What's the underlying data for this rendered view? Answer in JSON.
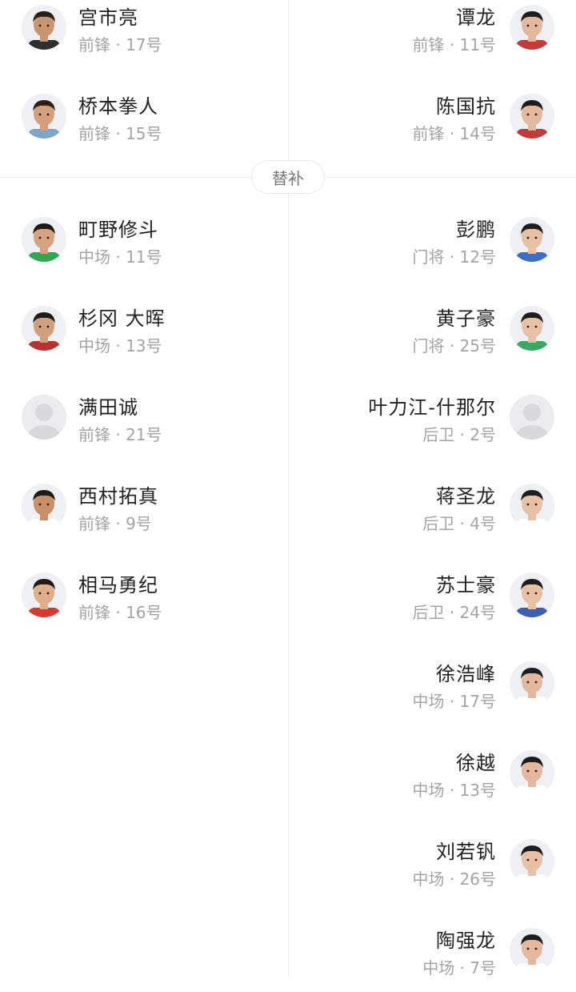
{
  "section": {
    "substitutes_label": "替补"
  },
  "starters": {
    "left": [
      {
        "name": "宫市亮",
        "position": "前锋",
        "number": "17号",
        "photo": "player-photo",
        "skin": "#c99672",
        "hair": "#2a1e17",
        "shirt": "#2f2f2f"
      },
      {
        "name": "桥本拳人",
        "position": "前锋",
        "number": "15号",
        "photo": "player-photo",
        "skin": "#d4a07c",
        "hair": "#2a1e17",
        "shirt": "#7fa6c9"
      }
    ],
    "right": [
      {
        "name": "谭龙",
        "position": "前锋",
        "number": "11号",
        "photo": "player-photo",
        "skin": "#e3b89c",
        "hair": "#1d1d1d",
        "shirt": "#c23a3a"
      },
      {
        "name": "陈国抗",
        "position": "前锋",
        "number": "14号",
        "photo": "player-photo",
        "skin": "#e3b89c",
        "hair": "#1d1d1d",
        "shirt": "#c23a3a"
      }
    ]
  },
  "substitutes": {
    "left": [
      {
        "name": "町野修斗",
        "position": "中场",
        "number": "11号",
        "photo": "player-photo",
        "skin": "#d6a27f",
        "hair": "#1f1a17",
        "shirt": "#2fa84f"
      },
      {
        "name": "杉冈 大晖",
        "position": "中场",
        "number": "13号",
        "photo": "player-photo",
        "skin": "#d0a07e",
        "hair": "#1f1a17",
        "shirt": "#b83232"
      },
      {
        "name": "满田诚",
        "position": "前锋",
        "number": "21号",
        "photo": "default-avatar",
        "skin": "",
        "hair": "",
        "shirt": ""
      },
      {
        "name": "西村拓真",
        "position": "前锋",
        "number": "9号",
        "photo": "player-photo",
        "skin": "#c98f68",
        "hair": "#1f1a17",
        "shirt": "#ffffff"
      },
      {
        "name": "相马勇纪",
        "position": "前锋",
        "number": "16号",
        "photo": "player-photo",
        "skin": "#e0ae8a",
        "hair": "#1f1a17",
        "shirt": "#d63a2e"
      }
    ],
    "right": [
      {
        "name": "彭鹏",
        "position": "门将",
        "number": "12号",
        "photo": "player-photo",
        "skin": "#e8c0a4",
        "hair": "#1d1d1d",
        "shirt": "#3a6fc9"
      },
      {
        "name": "黄子豪",
        "position": "门将",
        "number": "25号",
        "photo": "player-photo",
        "skin": "#e8c0a4",
        "hair": "#1d1d1d",
        "shirt": "#3aa863"
      },
      {
        "name": "叶力江-什那尔",
        "position": "后卫",
        "number": "2号",
        "photo": "default-avatar",
        "skin": "",
        "hair": "",
        "shirt": ""
      },
      {
        "name": "蒋圣龙",
        "position": "后卫",
        "number": "4号",
        "photo": "player-photo",
        "skin": "#e8c0a4",
        "hair": "#1d1d1d",
        "shirt": "#ffffff"
      },
      {
        "name": "苏士豪",
        "position": "后卫",
        "number": "24号",
        "photo": "player-photo",
        "skin": "#e8c0a4",
        "hair": "#1d1d1d",
        "shirt": "#3a5fb5"
      },
      {
        "name": "徐浩峰",
        "position": "中场",
        "number": "17号",
        "photo": "player-photo",
        "skin": "#e3b89c",
        "hair": "#1d1d1d",
        "shirt": "#ffffff"
      },
      {
        "name": "徐越",
        "position": "中场",
        "number": "13号",
        "photo": "player-photo",
        "skin": "#e3b89c",
        "hair": "#1d1d1d",
        "shirt": "#ffffff"
      },
      {
        "name": "刘若钒",
        "position": "中场",
        "number": "26号",
        "photo": "player-photo",
        "skin": "#e8c0a4",
        "hair": "#1d1d1d",
        "shirt": "#ffffff"
      },
      {
        "name": "陶强龙",
        "position": "中场",
        "number": "7号",
        "photo": "player-photo",
        "skin": "#e3b89c",
        "hair": "#1d1d1d",
        "shirt": "#ffffff"
      }
    ]
  },
  "colors": {
    "name_text": "#222222",
    "meta_text": "#a3a3a8",
    "divider": "#ececec"
  }
}
